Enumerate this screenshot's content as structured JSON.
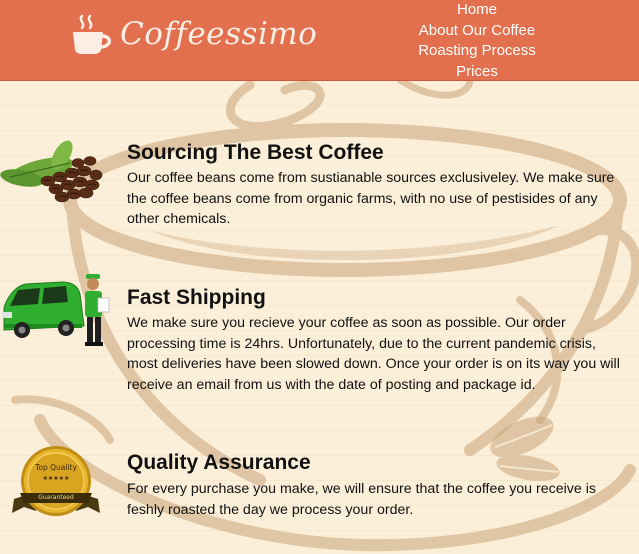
{
  "brand": {
    "name": "Coffeessimo",
    "icon": "coffee-cup-icon"
  },
  "nav": {
    "items": [
      "Home",
      "About Our Coffee",
      "Roasting Process",
      "Prices"
    ]
  },
  "sections": [
    {
      "title": "Sourcing The Best Coffee",
      "text": "Our coffee beans come from sustianable sources exclusiveley. We make sure the coffee beans come from organic farms, with no use of pestisides of any other chemicals.",
      "image": "coffee-beans-illustration"
    },
    {
      "title": "Fast Shipping",
      "text": "We make sure you recieve your coffee as soon as possible. Our order processing time is 24hrs. Unfortunately, due to the current pandemic crisis, most deliveries have been slowed down. Once your order is on its way you will receive an email from us with the date of posting and package id.",
      "image": "delivery-van-illustration"
    },
    {
      "title": "Quality Assurance",
      "text": "For every purchase you make, we will ensure that the coffee you receive is feshly roasted the day we process your order.",
      "image": "quality-badge-illustration"
    }
  ],
  "badge": {
    "line1": "Top Quality",
    "stars": "★★★★★",
    "line2": "Guaranteed"
  },
  "colors": {
    "header": "#e2704f",
    "background": "#fbefd9",
    "cup_art": "#c9a479",
    "van": "#2fae2f",
    "badge_gold": "#d9a520"
  }
}
